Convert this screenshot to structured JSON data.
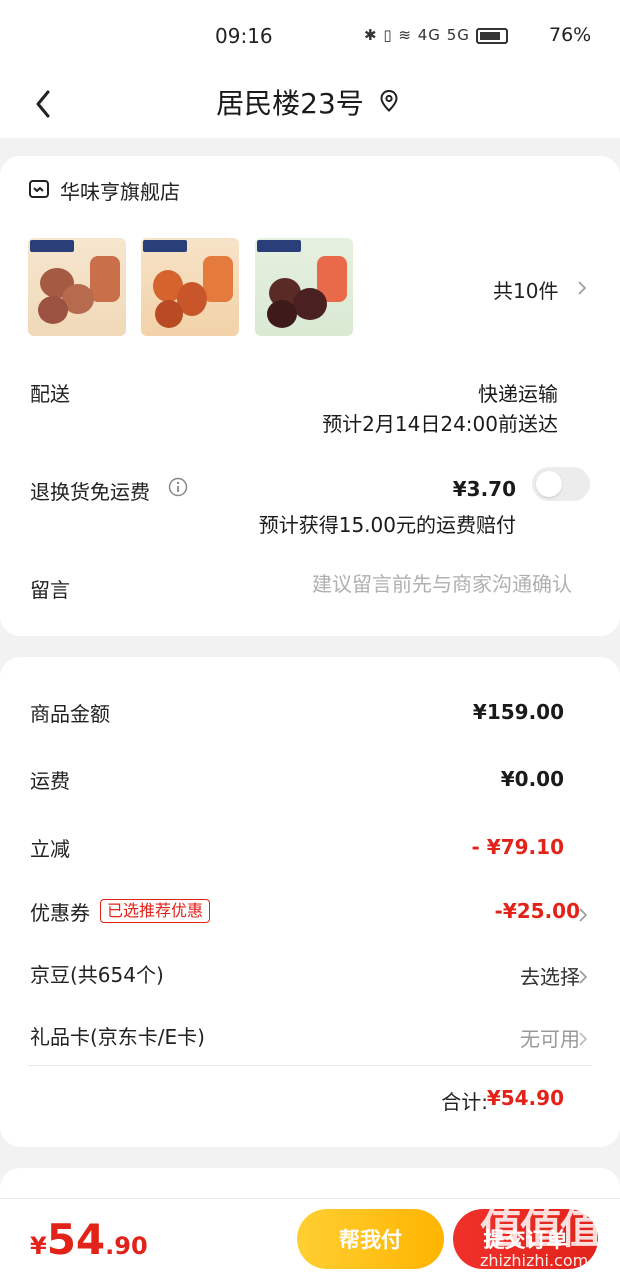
{
  "status_bar": {
    "time": "09:16",
    "network": "4G 5G",
    "battery": "76%"
  },
  "header": {
    "title": "居民楼23号"
  },
  "store": {
    "name": "华味亨旗舰店",
    "item_count": "共10件"
  },
  "delivery": {
    "label": "配送",
    "method": "快递运输",
    "eta": "预计2月14日24:00前送达"
  },
  "return_shipping": {
    "label": "退换货免运费",
    "price": "¥3.70",
    "compensation": "预计获得15.00元的运费赔付",
    "enabled": false
  },
  "note": {
    "label": "留言",
    "placeholder": "建议留言前先与商家沟通确认"
  },
  "summary": {
    "goods_amount_label": "商品金额",
    "goods_amount": "¥159.00",
    "shipping_label": "运费",
    "shipping": "¥0.00",
    "instant_discount_label": "立减",
    "instant_discount": "- ¥79.10",
    "coupon_label": "优惠券",
    "coupon_tag": "已选推荐优惠",
    "coupon_value": "-¥25.00",
    "jingdou_label": "京豆(共654个)",
    "jingdou_action": "去选择",
    "giftcard_label": "礼品卡(京东卡/E卡)",
    "giftcard_value": "无可用",
    "total_label": "合计:",
    "total_value": "¥54.90"
  },
  "bottom_bar": {
    "price_symbol": "¥",
    "price_integer": "54",
    "price_decimal": ".90",
    "pay_for_me_label": "帮我付",
    "submit_label": "提交订单"
  },
  "watermark": {
    "text": "zhizhizhi.com"
  },
  "colors": {
    "accent_red": "#e2231a",
    "accent_yellow": "#ffb400"
  }
}
